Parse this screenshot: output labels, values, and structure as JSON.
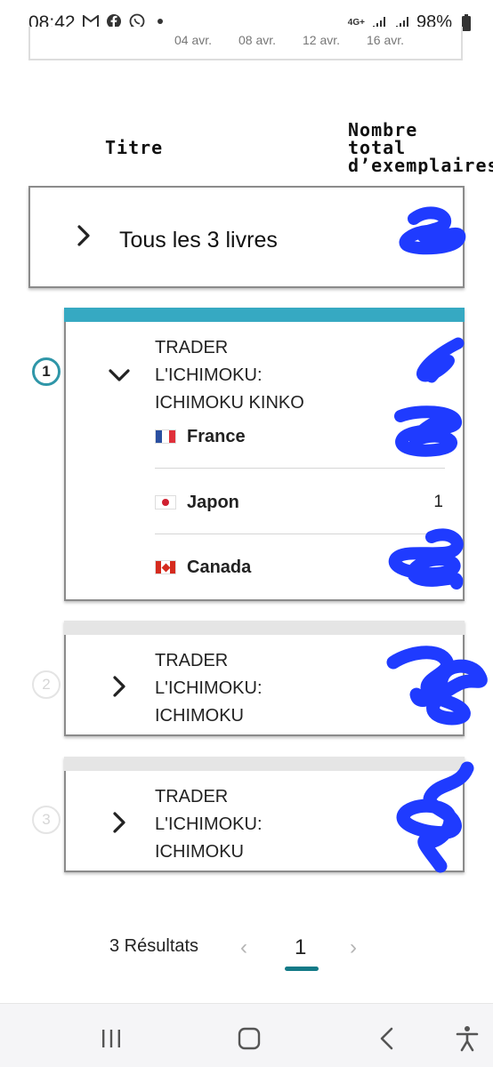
{
  "status_bar": {
    "time": "08:42",
    "left_icons": [
      "gmail-icon",
      "facebook-icon",
      "whatsapp-icon",
      "dot-icon"
    ],
    "network": "4G+",
    "battery": "98%"
  },
  "chart_remnant": {
    "x_ticks": [
      "04 avr.",
      "08 avr.",
      "12 avr.",
      "16 avr."
    ]
  },
  "table": {
    "col_title": "Titre",
    "col_total": "Nombre\ntotal\nd’exemplaires"
  },
  "all_books": {
    "label": "Tous les 3 livres"
  },
  "books": [
    {
      "rank": "1",
      "title": "TRADER\nL'ICHIMOKU:\nICHIMOKU KINKO",
      "expanded": true,
      "countries": [
        {
          "name": "France",
          "flag": "flag-france-icon",
          "value": ""
        },
        {
          "name": "Japon",
          "flag": "flag-japan-icon",
          "value": "1"
        },
        {
          "name": "Canada",
          "flag": "flag-canada-icon",
          "value": ""
        }
      ]
    },
    {
      "rank": "2",
      "title": "TRADER\nL'ICHIMOKU:\nICHIMOKU",
      "expanded": false
    },
    {
      "rank": "3",
      "title": "TRADER\nL'ICHIMOKU:\nICHIMOKU",
      "expanded": false
    }
  ],
  "pagination": {
    "results": "3 Résultats",
    "prev": "‹",
    "current": "1",
    "next": "›"
  },
  "colors": {
    "accent_teal": "#36a9c2",
    "page_underline": "#137a87",
    "redaction_blue": "#1f3bff"
  },
  "nav_bar": {
    "icons": [
      "recent-apps-icon",
      "home-icon",
      "back-icon",
      "accessibility-icon"
    ]
  }
}
